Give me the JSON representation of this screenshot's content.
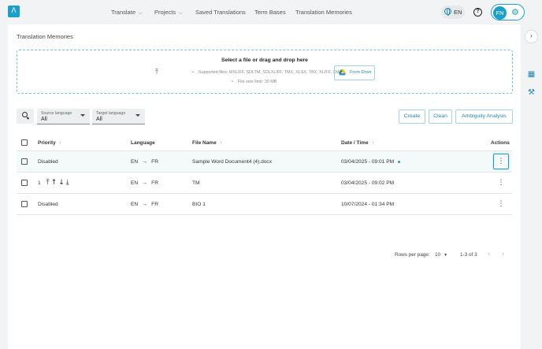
{
  "nav": {
    "translate": "Translate",
    "projects": "Projects",
    "saved_translations": "Saved Translations",
    "term_bases": "Term Bases",
    "translation_memories": "Translation Memories",
    "language": "EN",
    "user_initials": "FN"
  },
  "page": {
    "title": "Translation Memories"
  },
  "upload": {
    "title": "Select a file or drag and drop here",
    "supported": "Supported files: MXLIFF, SDLTM, SDLXLIFF, TMX, XLSX, TBX, XLIFF, XML",
    "size_limit": "File size limit: 30 MB",
    "from_drive": "From Drive"
  },
  "filters": {
    "source_label": "Source language",
    "source_value": "All",
    "target_label": "Target language",
    "target_value": "All"
  },
  "toolbar": {
    "create": "Create",
    "clean": "Clean",
    "ambiguity": "Ambiguity Analysis"
  },
  "table": {
    "headers": {
      "priority": "Priority",
      "language": "Language",
      "file_name": "File Name",
      "date_time": "Date / Time",
      "actions": "Actions"
    },
    "rows": [
      {
        "priority": "Disabled",
        "src": "EN",
        "tgt": "FR",
        "file": "Sample Word Document4 (4).docx",
        "date": "03/04/2025 - 09:01 PM"
      },
      {
        "priority": "1",
        "src": "EN",
        "tgt": "FR",
        "file": "TM",
        "date": "03/04/2025 - 09:02 PM"
      },
      {
        "priority": "Disabled",
        "src": "EN",
        "tgt": "FR",
        "file": "BIO 1",
        "date": "10/07/2024 - 01:34 PM"
      }
    ]
  },
  "pagination": {
    "rows_label": "Rows per page:",
    "rows_value": "10",
    "range": "1-3 of 3"
  },
  "colors": {
    "accent": "#1aa0c8",
    "accent_dark": "#1e88b4",
    "background": "#f1f3f4"
  }
}
